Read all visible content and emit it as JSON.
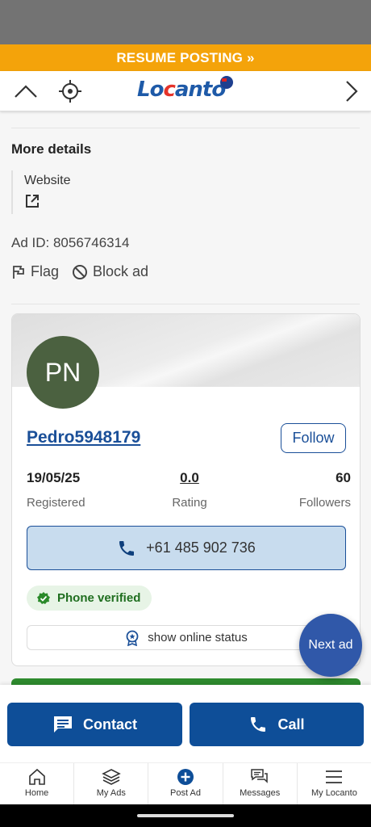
{
  "banner": {
    "resume_label": "RESUME POSTING »"
  },
  "header": {
    "logo_parts": [
      "Lo",
      "c",
      "anto"
    ],
    "logo_text": "Locanto"
  },
  "details": {
    "title": "More details",
    "website_label": "Website",
    "ad_id": "Ad ID: 8056746314",
    "flag_label": "Flag",
    "block_label": "Block ad"
  },
  "seller": {
    "initials": "PN",
    "username": "Pedro5948179",
    "follow_label": "Follow",
    "registered_value": "19/05/25",
    "registered_label": "Registered",
    "rating_value": "0.0",
    "rating_label": "Rating",
    "followers_value": "60",
    "followers_label": "Followers",
    "phone": "+61 485 902 736",
    "verified_label": "Phone verified",
    "online_label": "show online status"
  },
  "next_ad_label": "Next ad",
  "bottom": {
    "contact_label": "Contact",
    "call_label": "Call"
  },
  "tabs": [
    {
      "label": "Home",
      "icon": "home-icon"
    },
    {
      "label": "My Ads",
      "icon": "layers-icon"
    },
    {
      "label": "Post Ad",
      "icon": "plus-circle-icon"
    },
    {
      "label": "Messages",
      "icon": "messages-icon"
    },
    {
      "label": "My Locanto",
      "icon": "menu-icon"
    }
  ],
  "colors": {
    "brand_blue": "#0e4e98",
    "resume_orange": "#f4a30a",
    "avatar_green": "#4b6140",
    "verified_green": "#1f6e1f",
    "next_ad_blue": "#3058a9"
  }
}
